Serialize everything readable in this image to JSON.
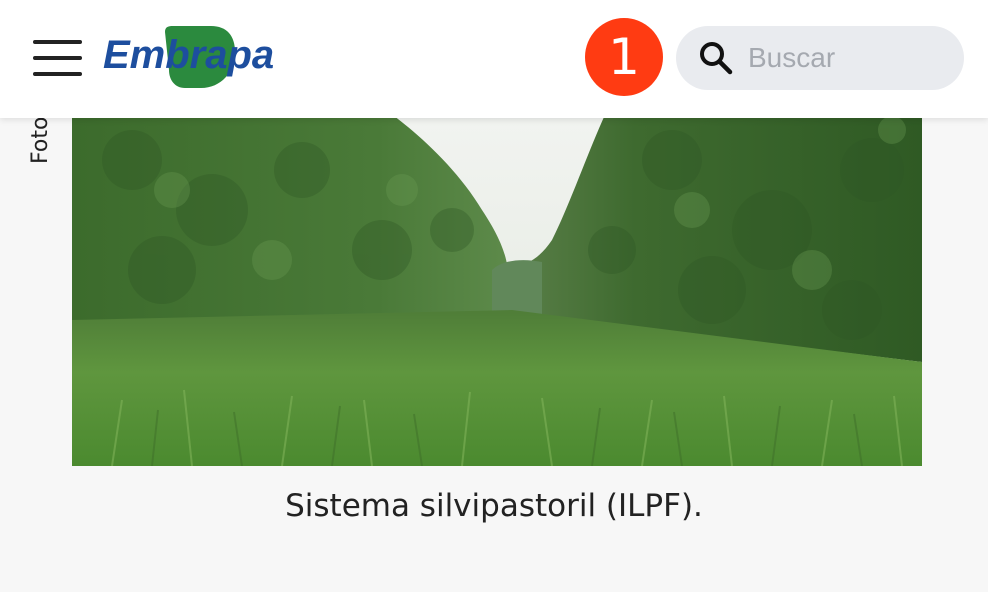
{
  "header": {
    "brand": "Embrapa",
    "notification_count": "1",
    "search": {
      "placeholder": "Buscar"
    }
  },
  "content": {
    "photo_credit_fragment": "Foto",
    "image_caption": "Sistema silvipastoril (ILPF)."
  },
  "icons": {
    "menu": "hamburger-menu-icon",
    "search": "search-icon"
  },
  "colors": {
    "brand_blue": "#1d4e9e",
    "brand_green": "#2b8a3e",
    "badge_red": "#ff3b12"
  }
}
